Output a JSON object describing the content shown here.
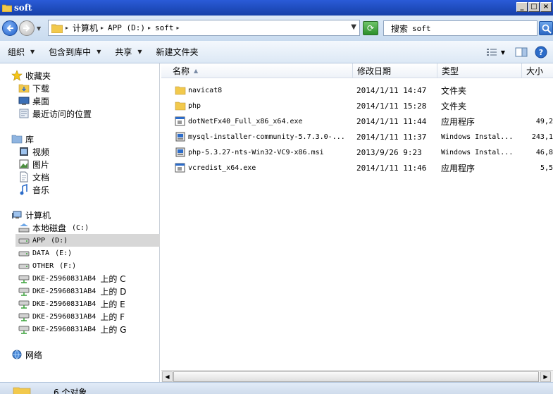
{
  "window": {
    "title": "soft",
    "minimize": "_",
    "maximize": "□",
    "close": "×"
  },
  "address": {
    "crumbs": [
      "计算机",
      "APP (D:)",
      "soft"
    ],
    "search_placeholder_prefix": "搜索",
    "search_placeholder_target": "soft"
  },
  "toolbar": {
    "organize": "组织",
    "include_in_library": "包含到库中",
    "share": "共享",
    "new_folder": "新建文件夹"
  },
  "nav": {
    "favorites": "收藏夹",
    "downloads": "下载",
    "desktop": "桌面",
    "recent": "最近访问的位置",
    "libraries": "库",
    "videos": "视频",
    "pictures": "图片",
    "documents": "文档",
    "music": "音乐",
    "computer": "计算机",
    "drives": [
      {
        "label": "本地磁盘",
        "letter": "(C:)"
      },
      {
        "label": "APP",
        "letter": "(D:)"
      },
      {
        "label": "DATA",
        "letter": "(E:)"
      },
      {
        "label": "OTHER",
        "letter": "(F:)"
      },
      {
        "label": "DKE-25960831AB4",
        "suffix": "上的 C"
      },
      {
        "label": "DKE-25960831AB4",
        "suffix": "上的 D"
      },
      {
        "label": "DKE-25960831AB4",
        "suffix": "上的 E"
      },
      {
        "label": "DKE-25960831AB4",
        "suffix": "上的 F"
      },
      {
        "label": "DKE-25960831AB4",
        "suffix": "上的 G"
      }
    ],
    "network": "网络"
  },
  "columns": {
    "name": "名称",
    "modified": "修改日期",
    "type": "类型",
    "size": "大小"
  },
  "files": [
    {
      "name": "navicat8",
      "modified": "2014/1/11 14:47",
      "type": "文件夹",
      "size": "",
      "icon": "folder-icon"
    },
    {
      "name": "php",
      "modified": "2014/1/11 15:28",
      "type": "文件夹",
      "size": "",
      "icon": "folder-icon"
    },
    {
      "name": "dotNetFx40_Full_x86_x64.exe",
      "modified": "2014/1/11 11:44",
      "type": "应用程序",
      "size": "49,2",
      "icon": "exe-icon"
    },
    {
      "name": "mysql-installer-community-5.7.3.0-...",
      "modified": "2014/1/11 11:37",
      "type": "Windows Instal...",
      "size": "243,1",
      "icon": "msi-icon"
    },
    {
      "name": "php-5.3.27-nts-Win32-VC9-x86.msi",
      "modified": "2013/9/26 9:23",
      "type": "Windows Instal...",
      "size": "46,8",
      "icon": "msi-icon"
    },
    {
      "name": "vcredist_x64.exe",
      "modified": "2014/1/11 11:46",
      "type": "应用程序",
      "size": "5,5",
      "icon": "exe-icon"
    }
  ],
  "status": {
    "count_text": "6 个对象"
  },
  "colors": {
    "title_bar": "#1f4fc4",
    "selected_nav": "#d7d7d7",
    "folder": "#f2c94c"
  }
}
